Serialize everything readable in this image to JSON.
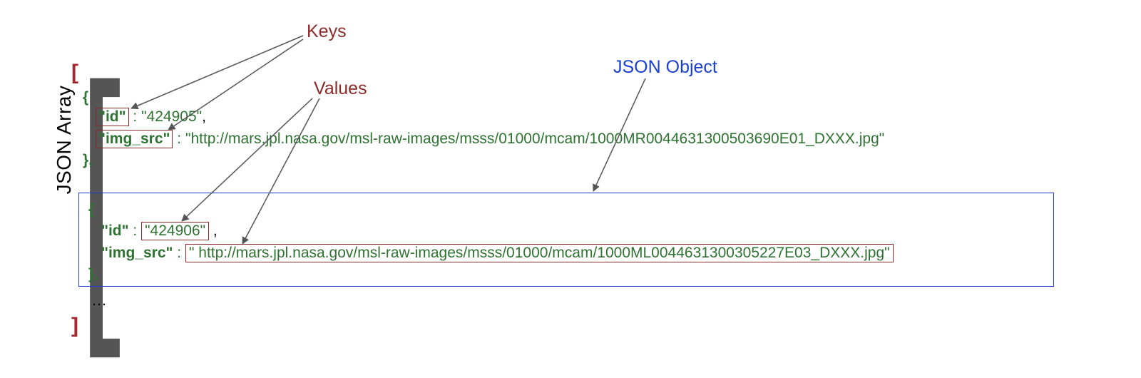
{
  "annotations": {
    "keys_label": "Keys",
    "values_label": "Values",
    "object_label": "JSON Object",
    "array_label": "JSON Array"
  },
  "brackets": {
    "outer_open": "[",
    "outer_close": "]",
    "inner_open": "[",
    "inner_close": "]",
    "brace_open": "{",
    "brace_close": "}",
    "brace_close_comma": "},",
    "ellipsis": "…",
    "colon": " : ",
    "comma": ","
  },
  "objects": [
    {
      "id_key": "\"id\"",
      "id_value": "\"424905\"",
      "img_key": "\"img_src\"",
      "img_value": "\"http://mars.jpl.nasa.gov/msl-raw-images/msss/01000/mcam/1000MR0044631300503690E01_DXXX.jpg\""
    },
    {
      "id_key": "\"id\"",
      "id_value": "\"424906\"",
      "img_key": "\"img_src\"",
      "img_value": "\" http://mars.jpl.nasa.gov/msl-raw-images/msss/01000/mcam/1000ML0044631300305227E03_DXXX.jpg\""
    }
  ]
}
